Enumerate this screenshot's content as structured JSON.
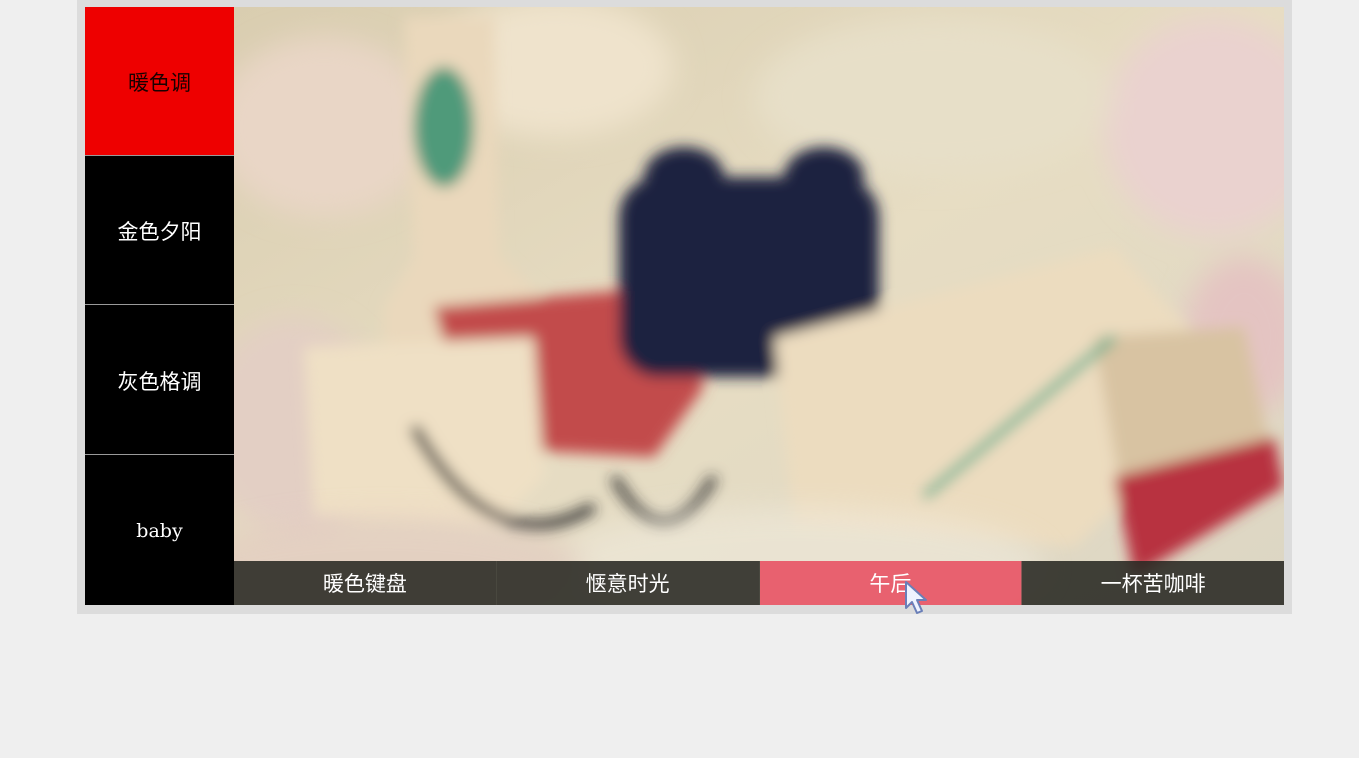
{
  "menu": {
    "items": [
      {
        "label": "暖色调",
        "active": true
      },
      {
        "label": "金色夕阳",
        "active": false
      },
      {
        "label": "灰色格调",
        "active": false
      },
      {
        "label": "baby",
        "active": false
      }
    ]
  },
  "captions": {
    "items": [
      {
        "label": "暖色键盘",
        "active": false
      },
      {
        "label": "惬意时光",
        "active": false
      },
      {
        "label": "午后",
        "active": true
      },
      {
        "label": "一杯苦咖啡",
        "active": false
      }
    ]
  },
  "colors": {
    "active_menu": "#ee0000",
    "active_caption": "#e85a69",
    "menu_bg": "#000000"
  },
  "icons": {
    "cursor": "mouse-pointer-icon"
  }
}
